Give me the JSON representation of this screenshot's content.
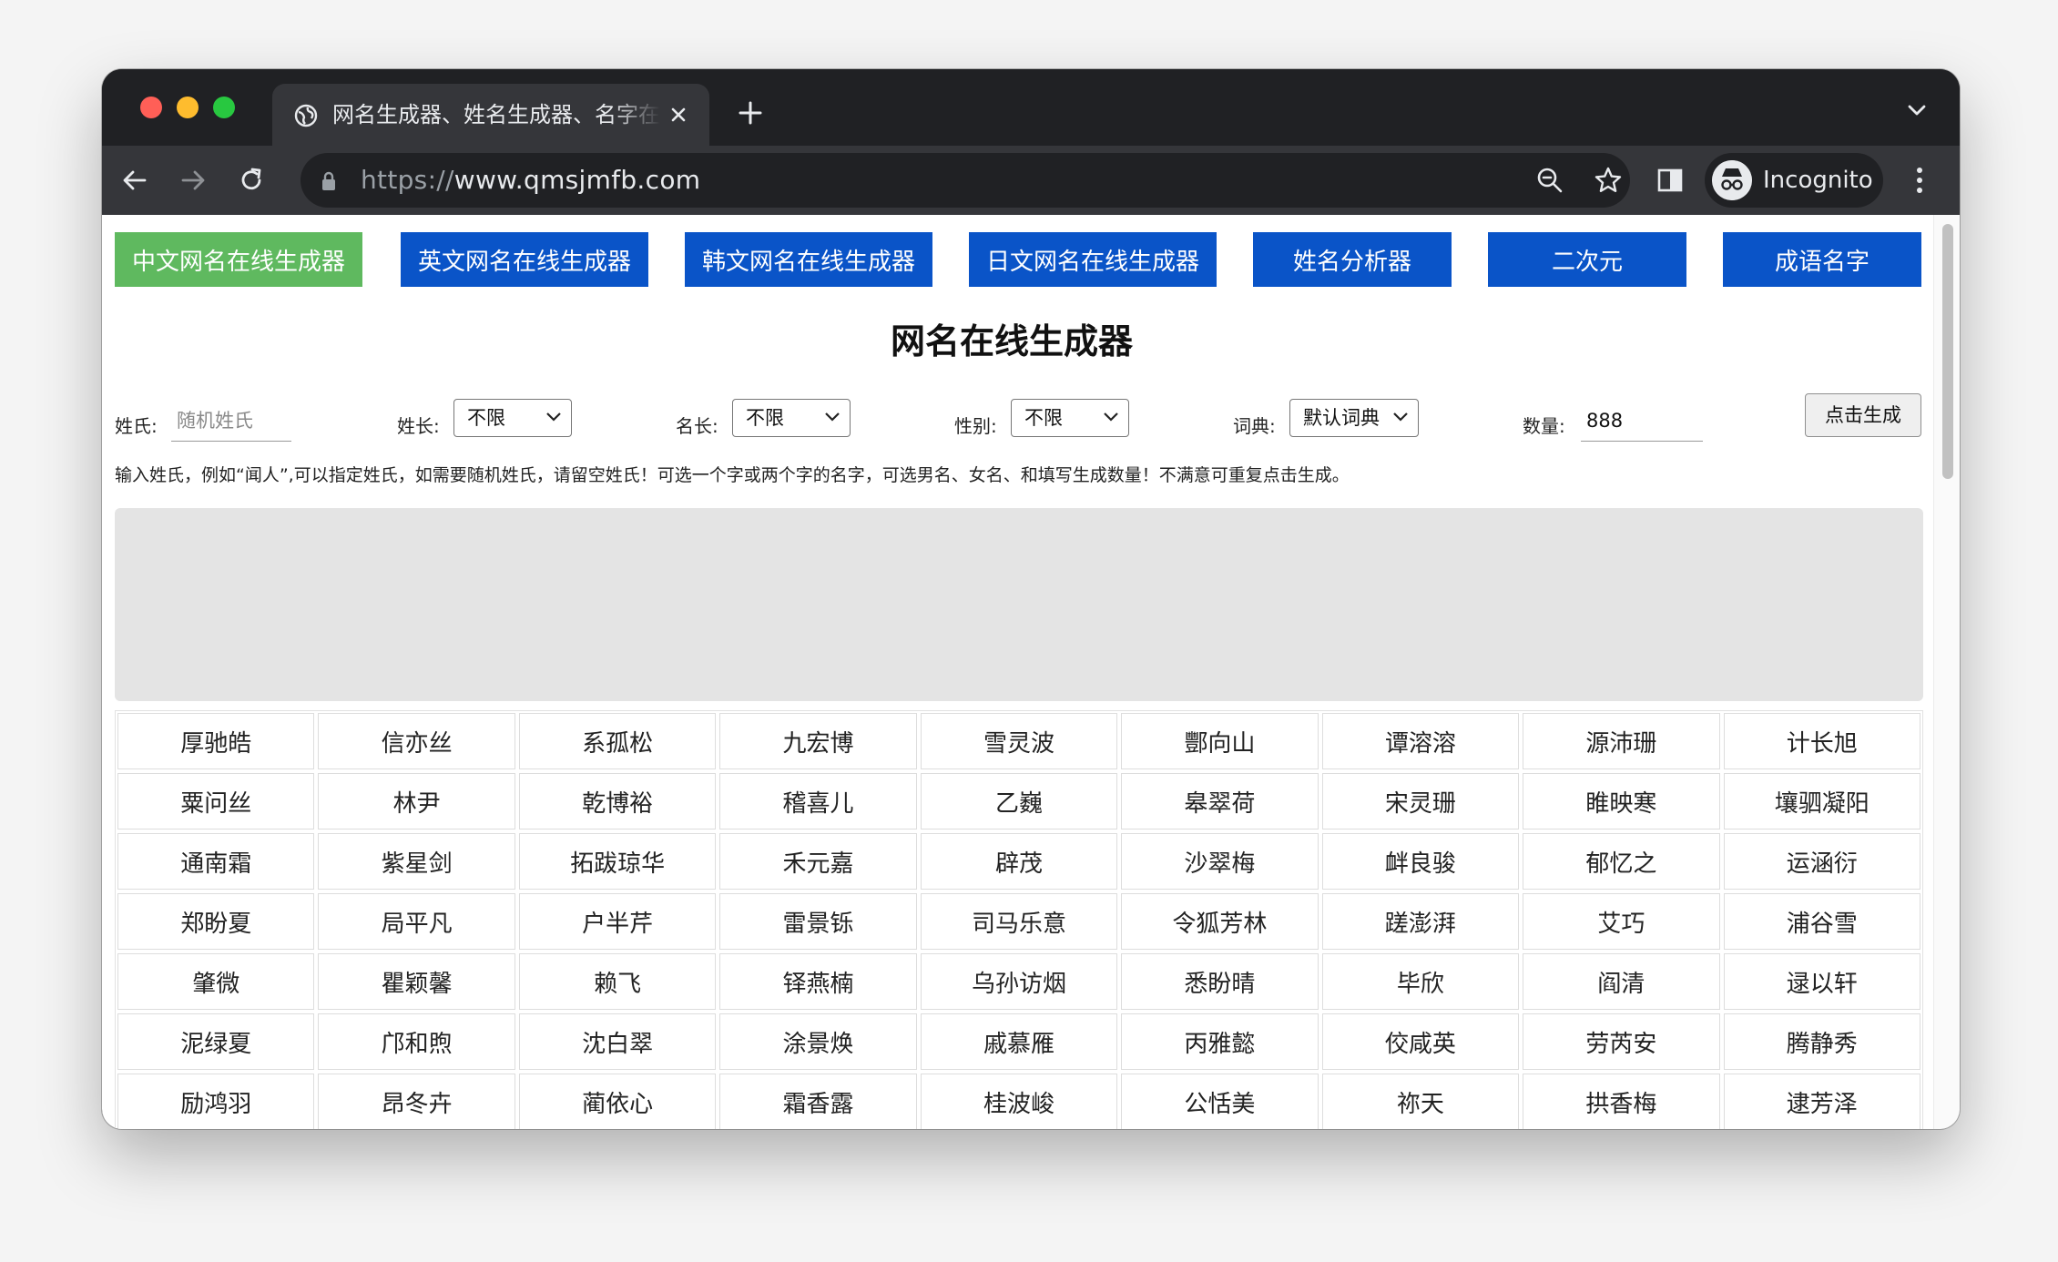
{
  "browser": {
    "tab_title": "网名生成器、姓名生成器、名字在线生成",
    "url_scheme": "https://",
    "url_host": "www.qmsjmfb.com",
    "incognito_label": "Incognito",
    "icons": [
      "globe-icon",
      "close-icon",
      "plus-icon",
      "chevron-down-icon",
      "back-icon",
      "forward-icon",
      "reload-icon",
      "lock-icon",
      "zoom-icon",
      "star-icon",
      "side-panel-icon",
      "incognito-icon",
      "more-vert-icon"
    ]
  },
  "nav": [
    {
      "label": "中文网名在线生成器",
      "active": true
    },
    {
      "label": "英文网名在线生成器",
      "active": false
    },
    {
      "label": "韩文网名在线生成器",
      "active": false
    },
    {
      "label": "日文网名在线生成器",
      "active": false
    },
    {
      "label": "姓名分析器",
      "active": false
    },
    {
      "label": "二次元",
      "active": false
    },
    {
      "label": "成语名字",
      "active": false
    }
  ],
  "colors": {
    "nav_blue": "#0a54c8",
    "nav_active_green": "#5fb95f"
  },
  "title": "网名在线生成器",
  "form": {
    "surname_label": "姓氏:",
    "surname_placeholder": "随机姓氏",
    "surname_length_label": "姓长:",
    "surname_length_value": "不限",
    "name_length_label": "名长:",
    "name_length_value": "不限",
    "gender_label": "性别:",
    "gender_value": "不限",
    "dict_label": "词典:",
    "dict_value": "默认词典",
    "count_label": "数量:",
    "count_value": "888",
    "generate_label": "点击生成"
  },
  "hint": "输入姓氏，例如“闻人”,可以指定姓氏，如需要随机姓氏，请留空姓氏！可选一个字或两个字的名字，可选男名、女名、和填写生成数量！不满意可重复点击生成。",
  "names": [
    [
      "厚驰皓",
      "信亦丝",
      "系孤松",
      "九宏博",
      "雪灵波",
      "酆向山",
      "谭溶溶",
      "源沛珊",
      "计长旭"
    ],
    [
      "粟问丝",
      "林尹",
      "乾博裕",
      "稽喜儿",
      "乙巍",
      "皋翠荷",
      "宋灵珊",
      "睢映寒",
      "壤驷凝阳"
    ],
    [
      "通南霜",
      "紫星剑",
      "拓跋琼华",
      "禾元嘉",
      "辟茂",
      "沙翠梅",
      "衅良骏",
      "郁忆之",
      "运涵衍"
    ],
    [
      "郑盼夏",
      "局平凡",
      "户半芹",
      "雷景铄",
      "司马乐意",
      "令狐芳林",
      "蹉澎湃",
      "艾巧",
      "浦谷雪"
    ],
    [
      "肇微",
      "瞿颖馨",
      "赖飞",
      "铎燕楠",
      "乌孙访烟",
      "悉盼晴",
      "毕欣",
      "阎清",
      "逯以轩"
    ],
    [
      "泥绿夏",
      "邝和煦",
      "沈白翠",
      "涂景焕",
      "戚慕雁",
      "丙雅懿",
      "佼咸英",
      "劳芮安",
      "腾静秀"
    ],
    [
      "励鸿羽",
      "昂冬卉",
      "蔺依心",
      "霜香露",
      "桂波峻",
      "公恬美",
      "祢天",
      "拱香梅",
      "逮芳泽"
    ]
  ]
}
